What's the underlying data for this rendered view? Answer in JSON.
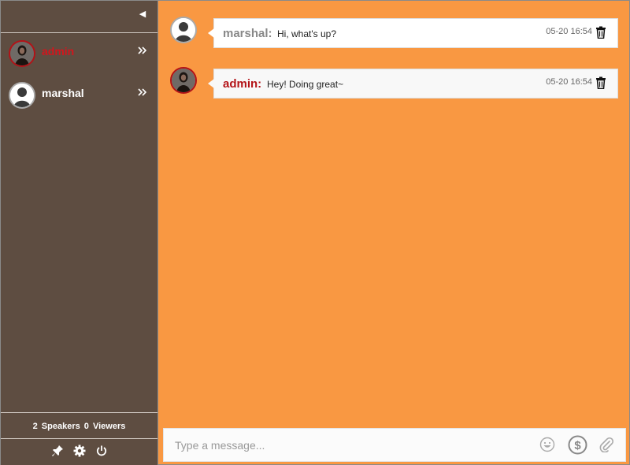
{
  "sidebar": {
    "collapse_icon": "collapse-left-icon",
    "users": [
      {
        "name": "admin",
        "role_color": "#d3151d",
        "arrow_icon": "double-chevron-right-icon"
      },
      {
        "name": "marshal",
        "role_color": "#ffffff",
        "arrow_icon": "double-chevron-right-icon"
      }
    ],
    "counts": {
      "speakers": "2",
      "speakers_label": "Speakers",
      "viewers": "0",
      "viewers_label": "Viewers"
    },
    "tools": [
      "pin-icon",
      "gear-icon",
      "power-icon"
    ]
  },
  "messages": [
    {
      "sender": "marshal:",
      "text": "Hi, what's up?",
      "time": "05-20 16:54"
    },
    {
      "sender": "admin:",
      "text": "Hey! Doing great~",
      "time": "05-20 16:54"
    }
  ],
  "composer": {
    "placeholder": "Type a message...",
    "icons": [
      "emoji-icon",
      "dollar-icon",
      "paperclip-icon"
    ]
  },
  "colors": {
    "background": "#f99842",
    "sidebar": "#5e4d41",
    "admin": "#b31217"
  }
}
